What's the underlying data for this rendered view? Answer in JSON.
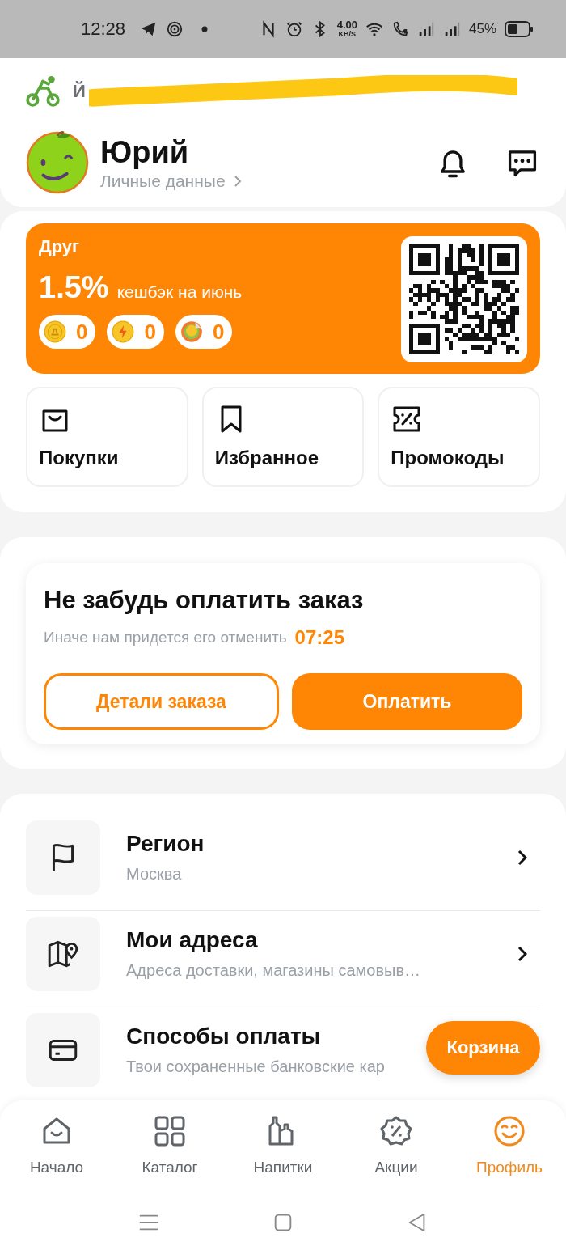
{
  "status_bar": {
    "time": "12:28",
    "net_speed": "4.00",
    "net_unit": "KB/S",
    "battery": "45%"
  },
  "banner": {
    "text": "Й",
    "redacted": true
  },
  "profile": {
    "name": "Юрий",
    "link": "Личные данные"
  },
  "loyalty_card": {
    "level_name": "Друг",
    "cashback": "1.5%",
    "cashback_label": "кешбэк на июнь",
    "balances": [
      {
        "kind": "coin",
        "value": "0"
      },
      {
        "kind": "bolt",
        "value": "0"
      },
      {
        "kind": "sticker",
        "value": "0"
      }
    ]
  },
  "shortcuts": [
    {
      "kind": "bag",
      "label": "Покупки"
    },
    {
      "kind": "bookmark",
      "label": "Избранное"
    },
    {
      "kind": "ticket",
      "label": "Промокоды"
    }
  ],
  "payment_reminder": {
    "title": "Не забудь оплатить заказ",
    "subtitle": "Иначе нам придется его отменить",
    "timer": "07:25",
    "buttons": [
      {
        "kind": "outline",
        "label": "Детали заказа"
      },
      {
        "kind": "filled",
        "label": "Оплатить"
      }
    ]
  },
  "settings": [
    {
      "kind": "flag",
      "title": "Регион",
      "subtitle": "Москва",
      "arrow": true
    },
    {
      "kind": "map",
      "title": "Мои адреса",
      "subtitle": "Адреса доставки, магазины самовыв…",
      "arrow": true
    },
    {
      "kind": "card",
      "title": "Способы оплаты",
      "subtitle": "Твои сохраненные банковские кар",
      "arrow": false
    }
  ],
  "cart_button": {
    "label": "Корзина"
  },
  "tab_bar": [
    {
      "kind": "home",
      "label": "Начало",
      "selected": false
    },
    {
      "kind": "grid",
      "label": "Каталог",
      "selected": false
    },
    {
      "kind": "bottles",
      "label": "Напитки",
      "selected": false
    },
    {
      "kind": "percent",
      "label": "Акции",
      "selected": false
    },
    {
      "kind": "smile",
      "label": "Профиль",
      "selected": true
    }
  ]
}
